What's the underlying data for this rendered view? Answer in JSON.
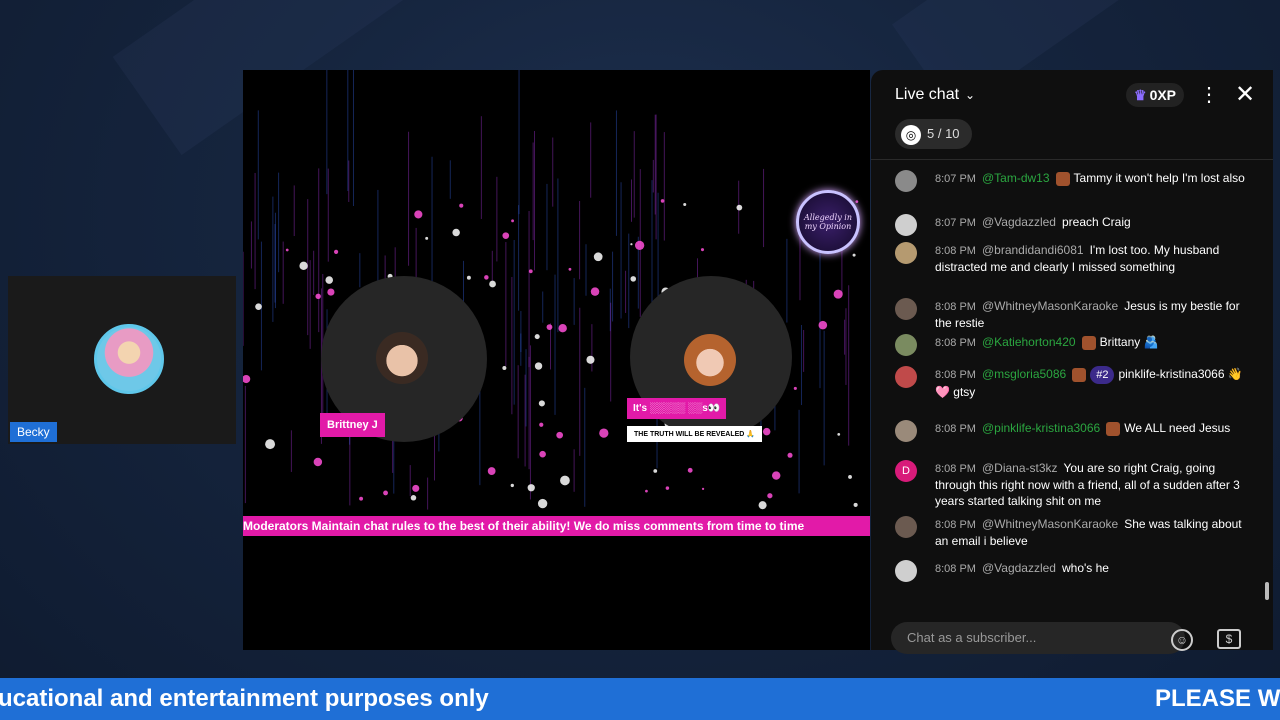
{
  "participant": {
    "name": "Becky"
  },
  "stage": {
    "guest_left_name": "Brittney J",
    "guest_right_label": "It's ░░░░░ ░░s👀",
    "guest_right_sublabel": "THE TRUTH WILL BE REVEALED 🙏",
    "logo_text": "Allegedly in my Opinion",
    "ticker": "Moderators Maintain chat rules to the best of their ability! We do miss comments from time to time"
  },
  "chat": {
    "title": "Live chat",
    "xp": "0XP",
    "goal": "5 / 10",
    "input_placeholder": "Chat as a subscriber...",
    "messages": [
      {
        "time": "8:07 PM",
        "author": "@Tam-dw13",
        "member": true,
        "text": "Tammy it won't help I'm lost also",
        "avatar_color": "#8a8a8a"
      },
      {
        "time": "8:07 PM",
        "author": "@Vagdazzled",
        "member": false,
        "text": "preach Craig",
        "avatar_color": "#cfcfcf"
      },
      {
        "time": "8:08 PM",
        "author": "@brandidandi6081",
        "member": false,
        "text": "I'm lost too. My husband distracted me and clearly I missed something",
        "avatar_color": "#b59a70"
      },
      {
        "time": "8:08 PM",
        "author": "@WhitneyMasonKaraoke",
        "member": false,
        "text": "Jesus is my bestie for the restie",
        "avatar_color": "#6b5a50"
      },
      {
        "time": "8:08 PM",
        "author": "@Katiehorton420",
        "member": true,
        "text": "Brittany 🫂",
        "avatar_color": "#7a8b60"
      },
      {
        "time": "8:08 PM",
        "author": "@msgloria5086",
        "member": true,
        "rank": "#2",
        "text": "pinklife-kristina3066 👋 🩷 gtsy",
        "avatar_color": "#c04a4a"
      },
      {
        "time": "8:08 PM",
        "author": "@pinklife-kristina3066",
        "member": true,
        "text": "We ALL need Jesus",
        "avatar_color": "#9a8a7a"
      },
      {
        "time": "8:08 PM",
        "author": "@Diana-st3kz",
        "member": false,
        "text": "You are so right Craig, going through this right now with a friend, all of a sudden after 3 years started talking shit on me",
        "avatar_color": "#d81b7a",
        "avatar_letter": "D"
      },
      {
        "time": "8:08 PM",
        "author": "@WhitneyMasonKaraoke",
        "member": false,
        "text": "She was talking about an email i believe",
        "avatar_color": "#6b5a50"
      },
      {
        "time": "8:08 PM",
        "author": "@Vagdazzled",
        "member": false,
        "text": "who's he",
        "avatar_color": "#cfcfcf"
      }
    ]
  },
  "banner": {
    "left": "ucational and entertainment purposes only",
    "right": "PLEASE W"
  }
}
